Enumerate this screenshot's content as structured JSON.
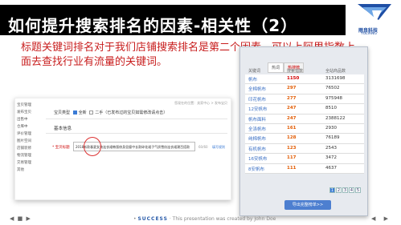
{
  "slide": {
    "title": "如何提升搜索排名的因素-相关性（2）",
    "body": "标题关键词排名对于我们店铺搜索排名是第二个因素，可以上阿里指数上面去查找行业有流量的关键词。",
    "logo": {
      "cn": "雨良科技",
      "en": "YULIANG"
    }
  },
  "shop_form": {
    "sidebar": [
      "宝贝管理",
      "发布宝贝",
      "出售中",
      "仓库中",
      "评价管理",
      "图片空间",
      "店铺装修",
      "物流管理",
      "交易管理",
      "其他"
    ],
    "breadcrumb": "您现在的位置：卖家中心 > 发布宝贝",
    "type_label": "宝贝类型",
    "type_new": "全新",
    "type_second": "二手（已发布过的宝贝如需修改请点击）",
    "basic_info": "基本信息",
    "title_label": "* 宝贝标题",
    "title_value": "2018新款春夏女装连衣裙韩版修身显瘦中长款碎花裙子气质雪纺连衣裙潮百搭款",
    "char_count": "60/60",
    "hint": "填写规则"
  },
  "panel": {
    "tabs": [
      "热词",
      "热搜榜"
    ],
    "headers": [
      "关键词",
      "搜索指数",
      "全站商品数"
    ],
    "rows": [
      {
        "kw": "帆布",
        "idx": "1150",
        "count": "3131698"
      },
      {
        "kw": "全棉帆布",
        "idx": "297",
        "count": "76502"
      },
      {
        "kw": "印花帆布",
        "idx": "277",
        "count": "975948"
      },
      {
        "kw": "12安帆布",
        "idx": "247",
        "count": "8510"
      },
      {
        "kw": "帆布面料",
        "idx": "247",
        "count": "2388122"
      },
      {
        "kw": "全涤帆布",
        "idx": "161",
        "count": "2930"
      },
      {
        "kw": "纯棉帆布",
        "idx": "128",
        "count": "76189"
      },
      {
        "kw": "有机帆布",
        "idx": "123",
        "count": "2543"
      },
      {
        "kw": "16安帆布",
        "idx": "117",
        "count": "3472"
      },
      {
        "kw": "8安帆布",
        "idx": "111",
        "count": "4637"
      }
    ],
    "pages": [
      "1",
      "2",
      "3",
      "4",
      "5"
    ],
    "more_button": "导出完整榜单>>"
  },
  "footer": {
    "nav_left": "◀ ■ ▶",
    "brand": "SUCCESS",
    "text": "This presentation was created by John Doe",
    "nav_right": "◀ ▶"
  }
}
